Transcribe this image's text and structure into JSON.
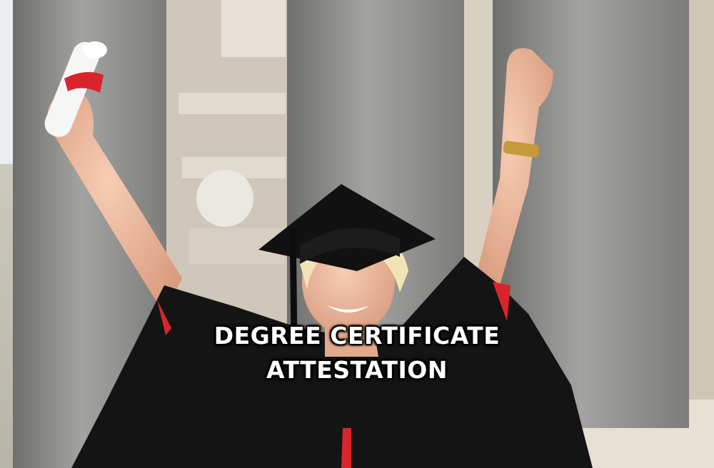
{
  "caption": {
    "line1": "DEGREE CERTIFICATE",
    "line2": "ATTESTATION"
  },
  "colors": {
    "column": "#8f8f8d",
    "gown": "#141414",
    "skin": "#f0c1a6",
    "accent_red": "#d8252c",
    "hair": "#f2e3b6"
  }
}
